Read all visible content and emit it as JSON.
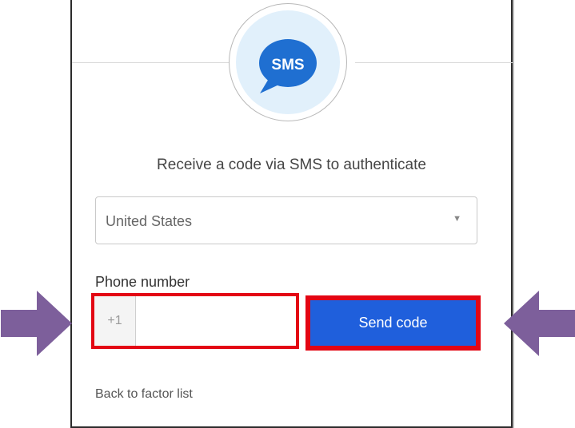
{
  "logo": {
    "text": "SMS",
    "icon": "sms-chat-bubble-icon"
  },
  "heading": "Receive a code via SMS to authenticate",
  "country_select": {
    "value": "United States",
    "caret": "▼"
  },
  "phone": {
    "label": "Phone number",
    "prefix": "+1",
    "value": "",
    "placeholder": ""
  },
  "send_button": {
    "label": "Send code"
  },
  "back_link": {
    "label": "Back to factor list"
  },
  "colors": {
    "highlight_border": "#e30613",
    "button": "#1f5fdc",
    "arrow": "#7d5f9b",
    "logo_bg": "#e1f0fb",
    "bubble": "#1f6fd1"
  }
}
